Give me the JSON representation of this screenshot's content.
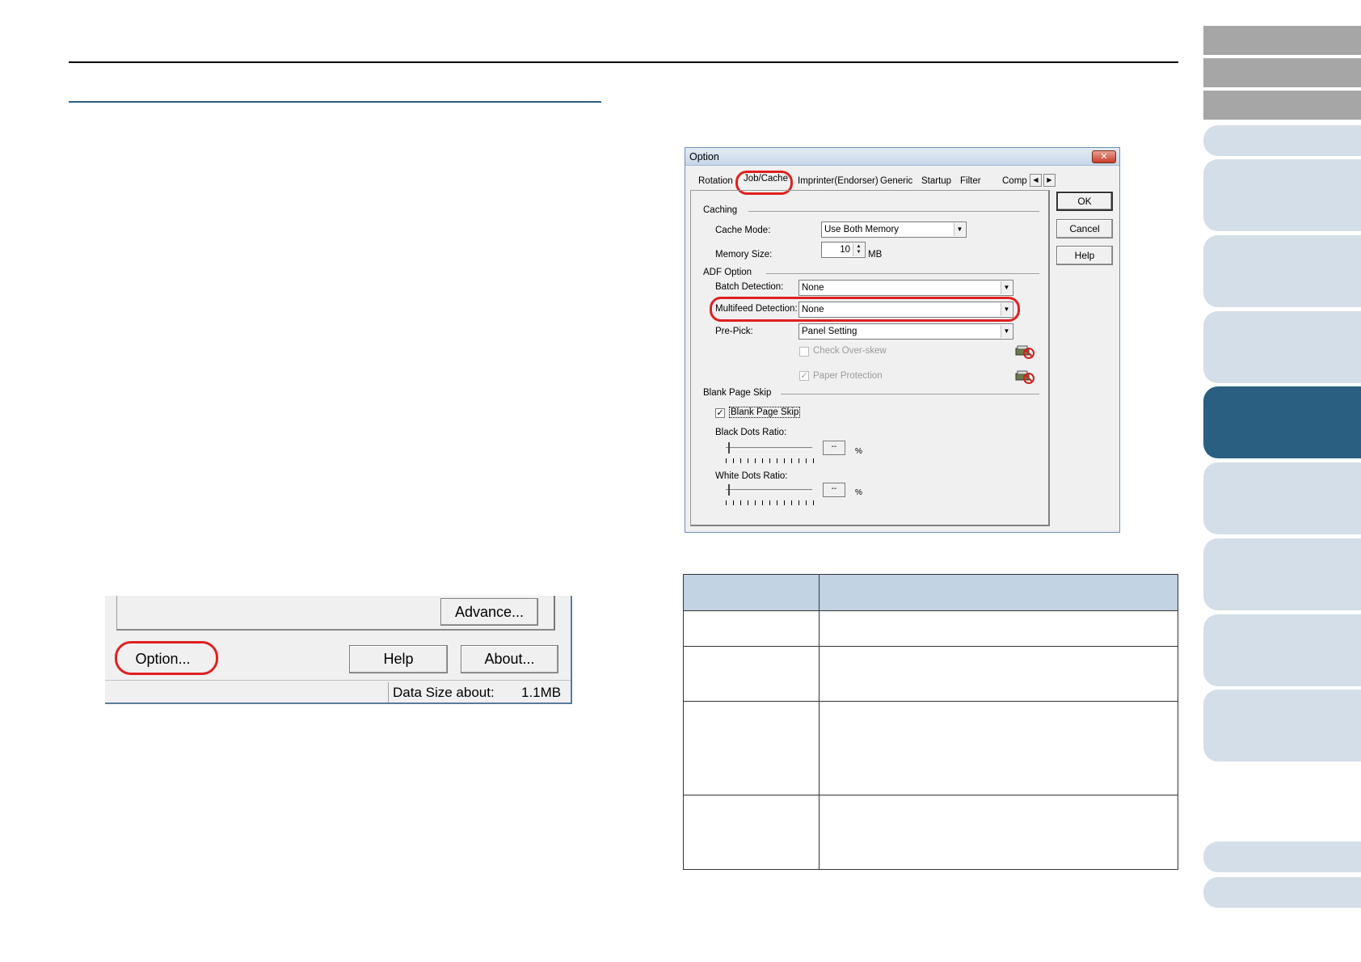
{
  "option_dialog": {
    "title": "Option",
    "tabs": [
      "Rotation",
      "Job/Cache",
      "Imprinter(Endorser)",
      "Generic",
      "Startup",
      "Filter",
      "Comp"
    ],
    "buttons": {
      "ok": "OK",
      "cancel": "Cancel",
      "help": "Help"
    },
    "caching": {
      "group_label": "Caching",
      "cache_mode_label": "Cache Mode:",
      "cache_mode_value": "Use Both Memory",
      "memory_size_label": "Memory Size:",
      "memory_size_value": "10",
      "memory_unit": "MB"
    },
    "adf": {
      "group_label": "ADF Option",
      "batch_label": "Batch Detection:",
      "batch_value": "None",
      "multifeed_label": "Multifeed Detection:",
      "multifeed_value": "None",
      "prepick_label": "Pre-Pick:",
      "prepick_value": "Panel Setting",
      "overskew_label": "Check Over-skew",
      "paper_protection_label": "Paper Protection"
    },
    "blank": {
      "group_label": "Blank Page Skip",
      "checkbox_label": "Blank Page Skip",
      "black_label": "Black Dots Ratio:",
      "white_label": "White Dots Ratio:",
      "value_placeholder": "--",
      "percent": "%"
    }
  },
  "main_dialog": {
    "advance_label": "Advance...",
    "option_label": "Option...",
    "help_label": "Help",
    "about_label": "About...",
    "data_size_label": "Data Size about:",
    "data_size_value": "1.1MB"
  },
  "colors": {
    "accent_red": "#e02020",
    "nav_dark": "#2a5f82",
    "nav_light": "#d3dee8",
    "table_header": "#c2d4e3"
  }
}
